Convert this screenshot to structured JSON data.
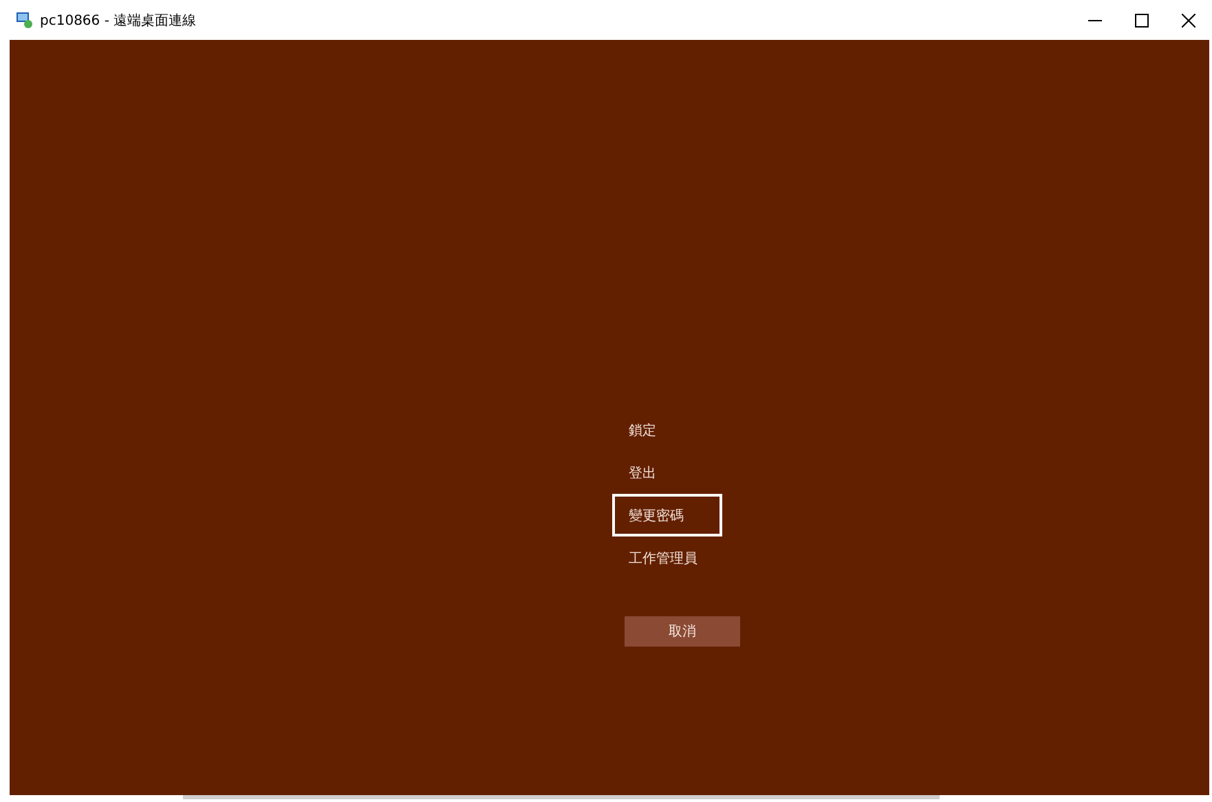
{
  "window": {
    "title": "pc10866 - 遠端桌面連線"
  },
  "menu": [
    {
      "label": "鎖定",
      "selected": false
    },
    {
      "label": "登出",
      "selected": false
    },
    {
      "label": "變更密碼",
      "selected": true
    },
    {
      "label": "工作管理員",
      "selected": false
    }
  ],
  "cancel_button": "取消"
}
